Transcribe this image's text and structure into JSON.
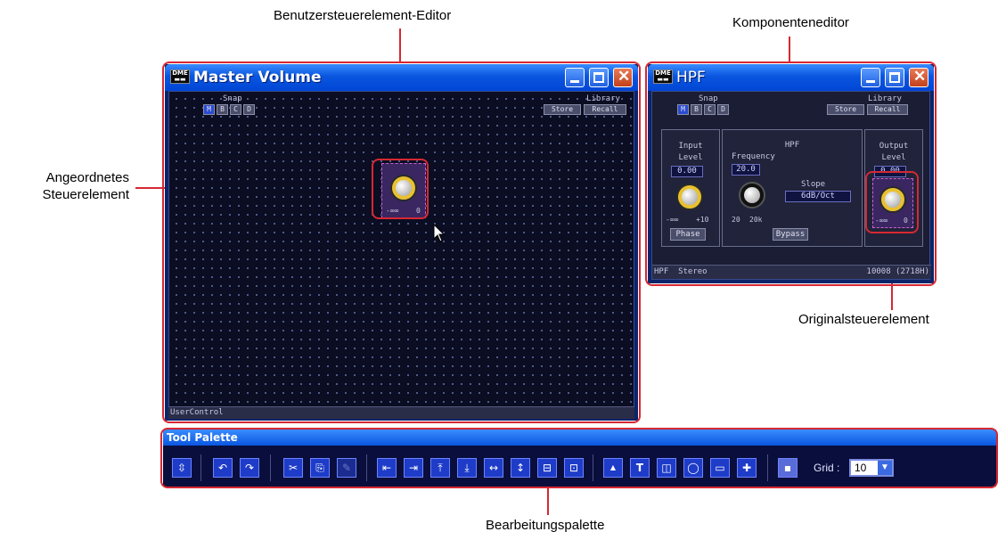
{
  "callouts": {
    "editor": "Benutzersteuerelement-Editor",
    "component": "Komponenteneditor",
    "placed_line1": "Angeordnetes",
    "placed_line2": "Steuerelement",
    "original": "Originalsteuerelement",
    "palette": "Bearbeitungspalette"
  },
  "master_window": {
    "title": "Master Volume",
    "snap_label": "Snap",
    "snap_buttons": [
      "M",
      "B",
      "C",
      "D"
    ],
    "library_label": "Library",
    "store": "Store",
    "recall": "Recall",
    "knob_min": "-∞∞",
    "knob_max": "0",
    "status": "UserControl"
  },
  "hpf_window": {
    "title": "HPF",
    "snap_label": "Snap",
    "snap_buttons": [
      "M",
      "B",
      "C",
      "D"
    ],
    "library_label": "Library",
    "store": "Store",
    "recall": "Recall",
    "input_header1": "Input",
    "input_header2": "Level",
    "input_value": "0.00",
    "input_min": "-∞∞",
    "input_max": "+10",
    "phase": "Phase",
    "hpf_header": "HPF",
    "frequency_label": "Frequency",
    "frequency_value": "20.0",
    "freq_min": "20",
    "freq_max": "20k",
    "slope_label": "Slope",
    "slope_value": "6dB/Oct",
    "bypass": "Bypass",
    "output_header1": "Output",
    "output_header2": "Level",
    "output_value": "0.00",
    "output_min": "-∞∞",
    "output_max": "0",
    "status_left": "HPF  Stereo",
    "status_right": "10008 (2718H)"
  },
  "tool_palette": {
    "title": "Tool Palette",
    "grid_label": "Grid :",
    "grid_value": "10"
  },
  "colors": {
    "highlight": "#d62832",
    "xp_blue": "#0a56e0"
  }
}
